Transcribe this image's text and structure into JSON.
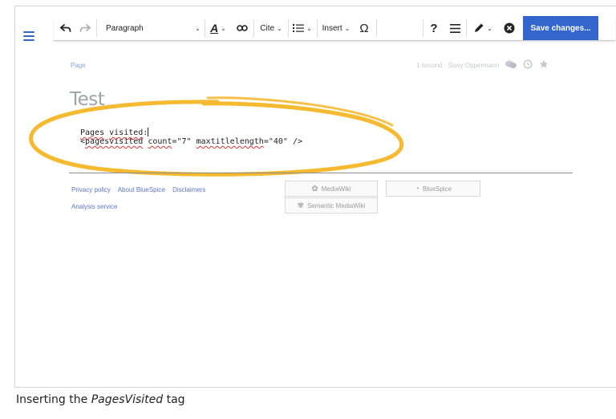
{
  "toolbar": {
    "undo_icon": "undo-arrow-icon",
    "redo_icon": "redo-arrow-icon",
    "paragraph_label": "Paragraph",
    "text_style_icon": "text-style-A-icon",
    "link_icon": "link-icon",
    "cite_label": "Cite",
    "list_icon": "bulleted-list-icon",
    "insert_label": "Insert",
    "special_char": "Ω",
    "help": "?",
    "page_options_icon": "menu-lines-icon",
    "edit_mode_icon": "pencil-icon",
    "close_icon": "close-circle-icon",
    "save_label": "Save changes..."
  },
  "page": {
    "tab_label": "Page",
    "meta_text": "1 second · Sissy Oppermann",
    "title": "Test",
    "code_line1_word1": "Pages",
    "code_line1_word2": "visited",
    "code_line1_rest": ":",
    "code_line2_open": "<",
    "code_line2_tag": "pagesvisited",
    "code_line2_space": " ",
    "code_line2_attr1": "count",
    "code_line2_val1": "=\"7\" ",
    "code_line2_attr2": "maxtitlelength",
    "code_line2_val2": "=\"40\" />",
    "highlight_color": "#f5b21b"
  },
  "footer": {
    "links_row1": [
      "Privacy policy",
      "About BlueSpice",
      "Disclaimers"
    ],
    "links_row2": [
      "Analysis service"
    ],
    "badges": {
      "mediawiki": "MediaWiki",
      "bluespice": "BlueSpice",
      "smw": "Semantic MediaWiki"
    }
  },
  "caption": {
    "prefix": "Inserting the ",
    "emph": "PagesVisited",
    "suffix": " tag"
  }
}
